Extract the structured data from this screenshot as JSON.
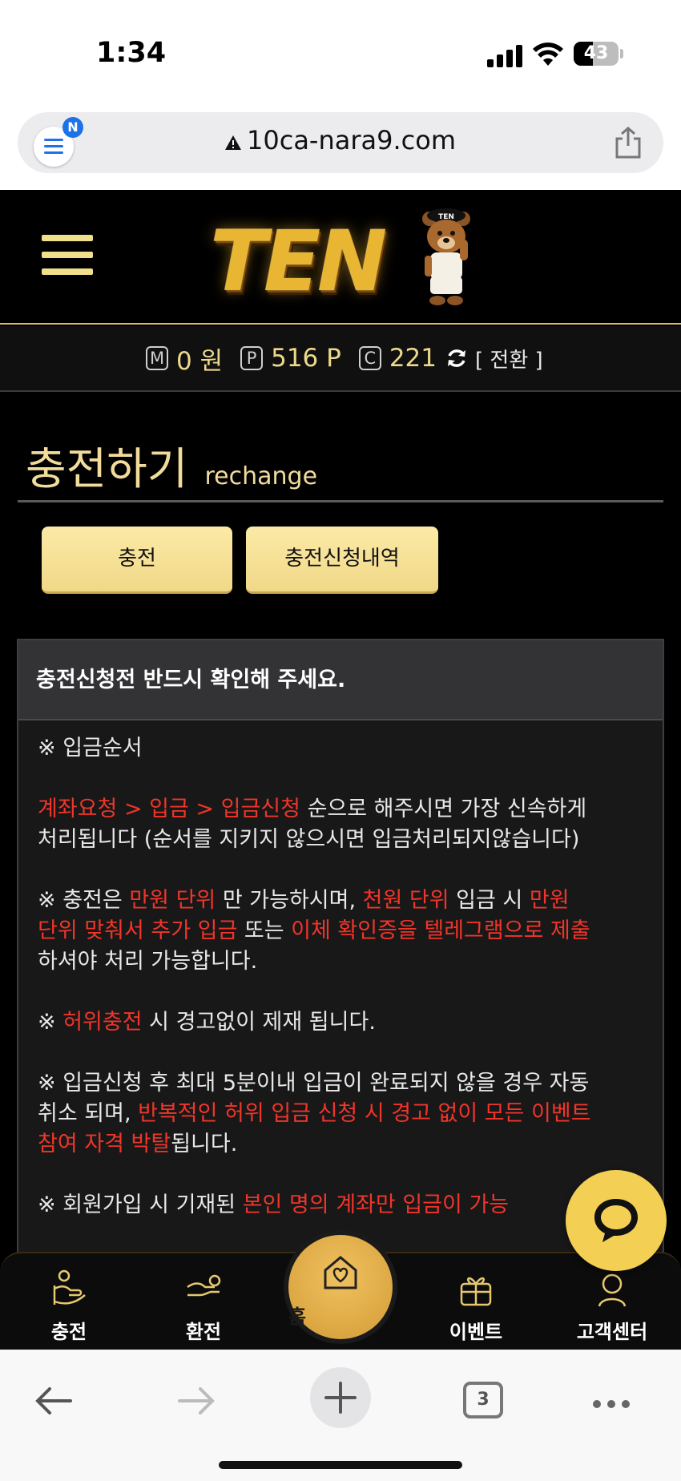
{
  "status_bar": {
    "time": "1:34",
    "battery": "43"
  },
  "browser": {
    "url": "10ca-nara9.com",
    "tab_count": "3",
    "extension_badge": "N"
  },
  "header": {
    "logo_text": "TEN",
    "bear_badge": "TEN"
  },
  "balance": {
    "money_icon": "M",
    "money": "0 원",
    "point_icon": "P",
    "points": "516 P",
    "coin_icon": "C",
    "coins": "221",
    "switch_label": "[ 전환 ]"
  },
  "page": {
    "title": "충전하기",
    "subtitle": "rechange"
  },
  "tabs": {
    "charge": "충전",
    "history": "충전신청내역"
  },
  "notice": {
    "heading": "충전신청전 반드시 확인해 주세요.",
    "order_title": "※ 입금순서",
    "order_red": "계좌요청 > 입금 > 입금신청",
    "order_rest1": " 순으로 해주시면 가장 신속하게",
    "order_line2": "처리됩니다 (순서를 지키지 않으시면 입금처리되지않습니다)",
    "unit_1": "※ 충전은 ",
    "unit_red1": "만원 단위",
    "unit_2": " 만 가능하시며, ",
    "unit_red2": "천원 단위",
    "unit_3": " 입금 시 ",
    "unit_red3": "만원",
    "unit_red4": "단위 맞춰서 추가 입금",
    "unit_4": " 또는 ",
    "unit_red5": "이체 확인증을 텔레그램으로 제출",
    "unit_line3": "하셔야 처리 가능합니다.",
    "false_1": "※ ",
    "false_red": "허위충전",
    "false_2": " 시 경고없이 제재 됩니다.",
    "cancel_line1": "※ 입금신청 후 최대 5분이내 입금이 완료되지 않을 경우 자동",
    "cancel_2": "취소 되며, ",
    "cancel_red1": "반복적인 허위 입금 신청 시 경고 없이 모든 이벤트",
    "cancel_red2": "참여 자격 박탈",
    "cancel_3": "됩니다.",
    "member_1": "※ 회원가입 시 기재된 ",
    "member_red": "본인 명의 계좌만 입금이 가능"
  },
  "bottom_nav": {
    "charge": "충전",
    "exchange": "환전",
    "home": "홈",
    "event": "이벤트",
    "support": "고객센터"
  }
}
